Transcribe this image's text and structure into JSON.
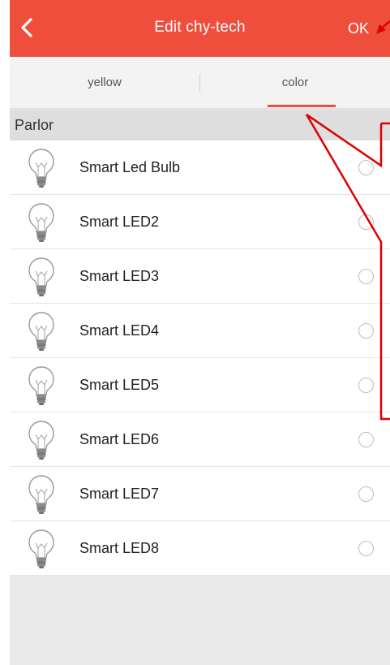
{
  "header": {
    "title": "Edit chy-tech",
    "ok_label": "OK"
  },
  "tabs": [
    {
      "label": "yellow",
      "active": false
    },
    {
      "label": "color",
      "active": true
    }
  ],
  "section": {
    "title": "Parlor"
  },
  "devices": [
    {
      "name": "Smart Led Bulb"
    },
    {
      "name": "Smart LED2"
    },
    {
      "name": "Smart LED3"
    },
    {
      "name": "Smart LED4"
    },
    {
      "name": "Smart LED5"
    },
    {
      "name": "Smart LED6"
    },
    {
      "name": "Smart LED7"
    },
    {
      "name": "Smart LED8"
    }
  ],
  "colors": {
    "accent": "#ef4e3d",
    "annotation": "#e00000",
    "background": "#e9e9e9"
  },
  "icons": {
    "back": "chevron-left-icon",
    "device": "light-bulb-icon"
  }
}
